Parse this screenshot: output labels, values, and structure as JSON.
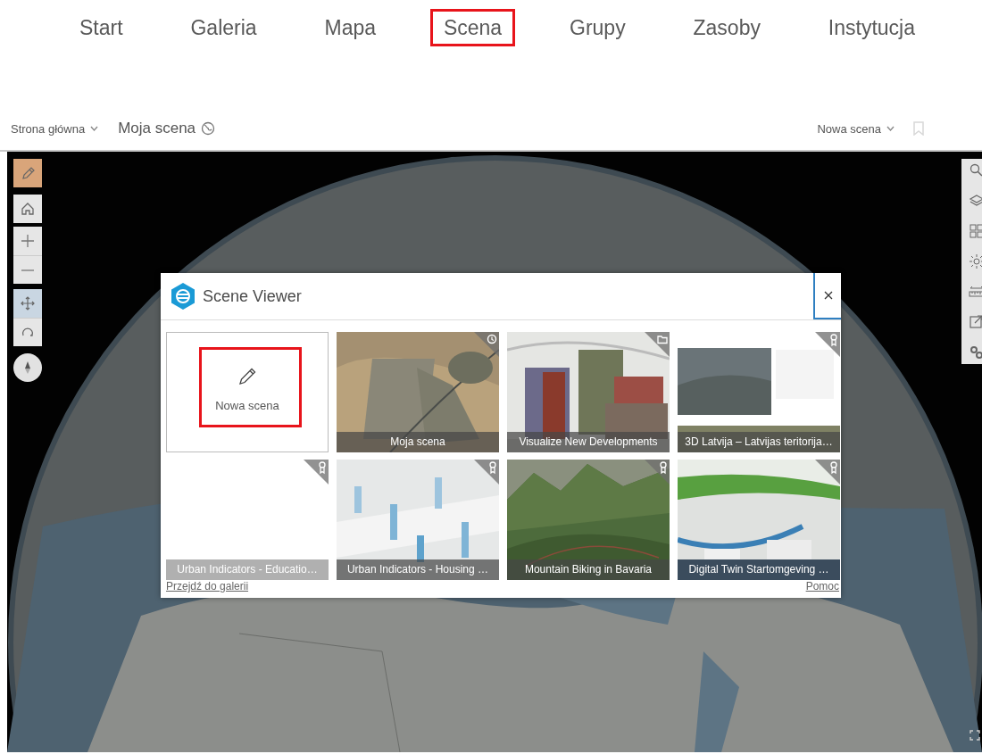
{
  "nav": [
    {
      "label": "Start",
      "highlighted": false
    },
    {
      "label": "Galeria",
      "highlighted": false
    },
    {
      "label": "Mapa",
      "highlighted": false
    },
    {
      "label": "Scena",
      "highlighted": true
    },
    {
      "label": "Grupy",
      "highlighted": false
    },
    {
      "label": "Zasoby",
      "highlighted": false
    },
    {
      "label": "Instytucja",
      "highlighted": false
    }
  ],
  "header": {
    "home_menu": "Strona główna",
    "scene_title": "Moja scena",
    "new_menu": "Nowa scena"
  },
  "left_tools": [
    {
      "kind": "edit",
      "selected": true
    },
    {
      "kind": "home",
      "selected": false
    },
    {
      "kind": "zoom-in",
      "selected": false
    },
    {
      "kind": "zoom-out",
      "selected": false
    },
    {
      "kind": "pan",
      "selected": true
    },
    {
      "kind": "rotate",
      "selected": false
    },
    {
      "kind": "compass",
      "selected": false
    }
  ],
  "right_tools": [
    {
      "kind": "search"
    },
    {
      "kind": "layers"
    },
    {
      "kind": "basemap"
    },
    {
      "kind": "daylight"
    },
    {
      "kind": "measure"
    },
    {
      "kind": "share"
    },
    {
      "kind": "settings"
    }
  ],
  "dialog": {
    "title": "Scene Viewer",
    "new_tile": {
      "label": "Nowa scena",
      "highlighted": true
    },
    "tiles": [
      {
        "caption": "Moja scena",
        "kind": "recent"
      },
      {
        "caption": "Visualize New Developments",
        "kind": "folder"
      },
      {
        "caption": "3D Latvija – Latvijas teritorija…",
        "kind": "award"
      },
      {
        "caption": "Urban Indicators - Educatio…",
        "kind": "award"
      },
      {
        "caption": "Urban Indicators - Housing …",
        "kind": "award"
      },
      {
        "caption": "Mountain Biking in Bavaria",
        "kind": "award"
      },
      {
        "caption": "Digital Twin Startomgeving …",
        "kind": "award"
      }
    ],
    "gallery_link": "Przejdź do galerii",
    "help_link": "Pomoc"
  }
}
